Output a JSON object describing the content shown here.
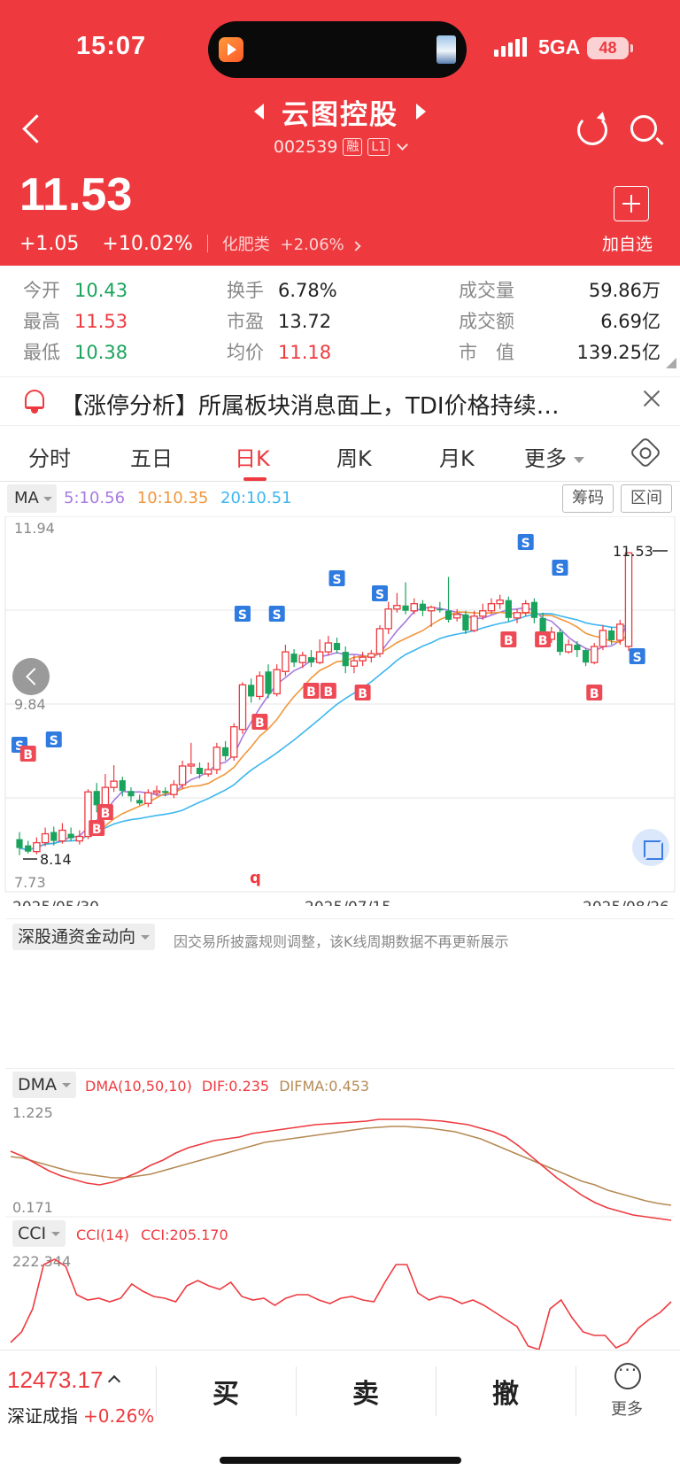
{
  "status": {
    "time": "15:07",
    "network": "5GA",
    "battery": "48"
  },
  "header": {
    "name": "云图控股",
    "code": "002539",
    "tag_margin": "融",
    "tag_level": "L1",
    "price": "11.53",
    "change": "+1.05",
    "change_pct": "+10.02%",
    "sector": "化肥类",
    "sector_pct": "+2.06%",
    "add_label": "加自选"
  },
  "stats": {
    "open_label": "今开",
    "open": "10.43",
    "high_label": "最高",
    "high": "11.53",
    "low_label": "最低",
    "low": "10.38",
    "turnover_label": "换手",
    "turnover": "6.78%",
    "pe_label": "市盈",
    "pe": "13.72",
    "avg_label": "均价",
    "avg": "11.18",
    "volume_label": "成交量",
    "volume": "59.86万",
    "amount_label": "成交额",
    "amount": "6.69亿",
    "mcap_label": "市　值",
    "mcap": "139.25亿"
  },
  "banner": {
    "text": "【涨停分析】所属板块消息面上，TDI价格持续…"
  },
  "tabs": [
    "分时",
    "五日",
    "日K",
    "周K",
    "月K",
    "更多"
  ],
  "active_tab": "日K",
  "ma": {
    "selector": "MA",
    "ma5": "5:10.56",
    "ma10": "10:10.35",
    "ma20": "20:10.51",
    "chips_btn": "筹码",
    "range_btn": "区间"
  },
  "kline": {
    "y_top": "11.94",
    "y_mid": "9.84",
    "y_bottom": "7.73",
    "latest_mark": "11.53",
    "low_mark": "8.14",
    "dates": [
      "2025/05/30",
      "2025/07/15",
      "2025/08/26"
    ]
  },
  "flow": {
    "label": "深股通资金动向",
    "note": "因交易所披露规则调整，该K线周期数据不再更新展示"
  },
  "dma": {
    "label": "DMA",
    "params": "DMA(10,50,10)",
    "dif": "DIF:0.235",
    "difma": "DIFMA:0.453",
    "y_top": "1.225",
    "y_bottom": "0.171"
  },
  "cci": {
    "label": "CCI",
    "params": "CCI(14)",
    "value": "CCI:205.170",
    "y_top": "222.344"
  },
  "bottom": {
    "index_value": "12473.17",
    "index_name": "深证成指",
    "index_pct": "+0.26%",
    "buy": "买",
    "sell": "卖",
    "cancel": "撤",
    "more": "更多"
  },
  "colors": {
    "up": "#ee3a3f",
    "down": "#1aa35c",
    "ma5": "#a77be0",
    "ma10": "#f0973c",
    "ma20": "#3db6ef"
  }
}
